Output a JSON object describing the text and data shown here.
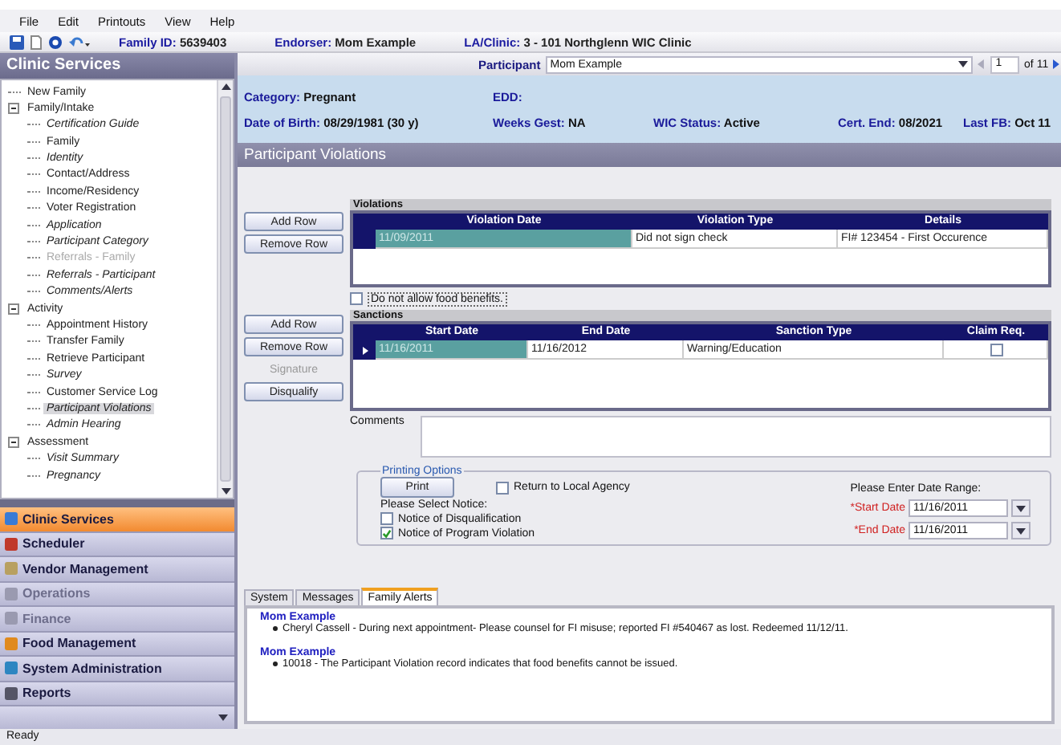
{
  "menu": [
    "File",
    "Edit",
    "Printouts",
    "View",
    "Help"
  ],
  "toolbar": {
    "fields": [
      {
        "label": "Family ID:",
        "value": "5639403"
      },
      {
        "label": "Endorser:",
        "value": "Mom Example"
      },
      {
        "label": "LA/Clinic:",
        "value": "3 - 101 Northglenn WIC Clinic"
      }
    ]
  },
  "sidebar": {
    "title": "Clinic Services",
    "tree": [
      {
        "label": "New Family",
        "italic": false,
        "disabled": false,
        "selected": false
      },
      {
        "label": "Family/Intake",
        "italic": false,
        "disabled": false,
        "selected": false,
        "expanded": true,
        "children": [
          {
            "label": "Certification Guide",
            "italic": true,
            "disabled": false,
            "selected": false
          },
          {
            "label": "Family",
            "italic": false,
            "disabled": false,
            "selected": false
          },
          {
            "label": "Identity",
            "italic": true,
            "disabled": false,
            "selected": false
          },
          {
            "label": "Contact/Address",
            "italic": false,
            "disabled": false,
            "selected": false
          },
          {
            "label": "Income/Residency",
            "italic": false,
            "disabled": false,
            "selected": false
          },
          {
            "label": "Voter Registration",
            "italic": false,
            "disabled": false,
            "selected": false
          },
          {
            "label": "Application",
            "italic": true,
            "disabled": false,
            "selected": false
          },
          {
            "label": "Participant Category",
            "italic": true,
            "disabled": false,
            "selected": false
          },
          {
            "label": "Referrals - Family",
            "italic": false,
            "disabled": true,
            "selected": false
          },
          {
            "label": "Referrals - Participant",
            "italic": true,
            "disabled": false,
            "selected": false
          },
          {
            "label": "Comments/Alerts",
            "italic": true,
            "disabled": false,
            "selected": false
          }
        ]
      },
      {
        "label": "Activity",
        "italic": false,
        "disabled": false,
        "selected": false,
        "expanded": true,
        "children": [
          {
            "label": "Appointment History",
            "italic": false,
            "disabled": false,
            "selected": false
          },
          {
            "label": "Transfer Family",
            "italic": false,
            "disabled": false,
            "selected": false
          },
          {
            "label": "Retrieve Participant",
            "italic": false,
            "disabled": false,
            "selected": false
          },
          {
            "label": "Survey",
            "italic": true,
            "disabled": false,
            "selected": false
          },
          {
            "label": "Customer Service Log",
            "italic": false,
            "disabled": false,
            "selected": false
          },
          {
            "label": "Participant Violations",
            "italic": true,
            "disabled": false,
            "selected": true
          },
          {
            "label": "Admin Hearing",
            "italic": true,
            "disabled": false,
            "selected": false
          }
        ]
      },
      {
        "label": "Assessment",
        "italic": false,
        "disabled": false,
        "selected": false,
        "expanded": true,
        "children": [
          {
            "label": "Visit Summary",
            "italic": true,
            "disabled": false,
            "selected": false
          },
          {
            "label": "Pregnancy",
            "italic": true,
            "disabled": false,
            "selected": false
          }
        ]
      }
    ],
    "modules": [
      {
        "label": "Clinic Services",
        "selected": true,
        "disabled": false,
        "color": "#3a7bd5"
      },
      {
        "label": "Scheduler",
        "selected": false,
        "disabled": false,
        "color": "#c0392b"
      },
      {
        "label": "Vendor Management",
        "selected": false,
        "disabled": false,
        "color": "#b8a060"
      },
      {
        "label": "Operations",
        "selected": false,
        "disabled": true,
        "color": "#9a9ab0"
      },
      {
        "label": "Finance",
        "selected": false,
        "disabled": true,
        "color": "#9a9ab0"
      },
      {
        "label": "Food Management",
        "selected": false,
        "disabled": false,
        "color": "#e08a1e"
      },
      {
        "label": "System Administration",
        "selected": false,
        "disabled": false,
        "color": "#2e86c1"
      },
      {
        "label": "Reports",
        "selected": false,
        "disabled": false,
        "color": "#555566"
      }
    ]
  },
  "participant_bar": {
    "label": "Participant",
    "value": "Mom Example",
    "page": "1",
    "page_count": "of 11"
  },
  "info": [
    [
      {
        "label": "Category:",
        "value": "Pregnant"
      },
      {
        "label": "EDD:"
      }
    ],
    [
      {
        "label": "Date of Birth:",
        "value": "08/29/1981   (30 y)"
      },
      {
        "label": "Weeks Gest:",
        "value": "NA"
      },
      {
        "label": "WIC Status:",
        "value": "Active"
      },
      {
        "label": "Cert. End:",
        "value": "08/2021"
      },
      {
        "label": "Last FB:",
        "value": "Oct 11"
      }
    ]
  ],
  "page_title": "Participant Violations",
  "violations": {
    "title": "Violations",
    "buttons": [
      {
        "label": "Add Row",
        "disabled": false
      },
      {
        "label": "Remove Row",
        "disabled": false
      }
    ],
    "columns": [
      "Violation Date",
      "Violation Type",
      "Details"
    ],
    "rows": [
      {
        "cells": [
          "11/09/2011",
          "Did not sign check",
          "FI# 123454 - First Occurence"
        ],
        "selected": true,
        "current": false
      }
    ]
  },
  "food_checkbox": {
    "label": "Do not allow food benefits.",
    "checked": false
  },
  "sanctions": {
    "title": "Sanctions",
    "buttons": [
      {
        "label": "Add Row",
        "disabled": false
      },
      {
        "label": "Remove Row",
        "disabled": false
      },
      {
        "label": "Signature",
        "disabled": true
      },
      {
        "label": "Disqualify",
        "disabled": false
      }
    ],
    "columns": [
      "Start Date",
      "End Date",
      "Sanction Type",
      "Claim Req."
    ],
    "rows": [
      {
        "cells": [
          "11/16/2011",
          "11/16/2012",
          "Warning/Education"
        ],
        "claim_req": false,
        "selected": true,
        "current": true
      }
    ]
  },
  "comments": {
    "label": "Comments"
  },
  "printing": {
    "title": "Printing Options",
    "print": "Print",
    "return_checkbox": {
      "label": "Return to Local Agency",
      "checked": false
    },
    "notice_label": "Please Select Notice:",
    "notices": [
      {
        "label": "Notice of Disqualification",
        "checked": false
      },
      {
        "label": "Notice of Program Violation",
        "checked": true
      }
    ],
    "date_range_label": "Please Enter Date Range:",
    "dates": [
      {
        "label": "*Start Date",
        "value": "11/16/2011"
      },
      {
        "label": "*End Date",
        "value": "11/16/2011"
      }
    ]
  },
  "bottom_tabs": [
    {
      "label": "System",
      "selected": false
    },
    {
      "label": "Messages",
      "selected": false
    },
    {
      "label": "Family Alerts",
      "selected": true
    }
  ],
  "alerts": [
    {
      "name": "Mom Example",
      "items": [
        "Cheryl Cassell - During next appointment-  Please counsel for FI misuse; reported FI #540467  as lost.  Redeemed 11/12/11."
      ]
    },
    {
      "name": "Mom Example",
      "items": [
        "10018 - The Participant Violation record indicates that food benefits cannot be issued."
      ]
    }
  ],
  "status_bar": "Ready"
}
